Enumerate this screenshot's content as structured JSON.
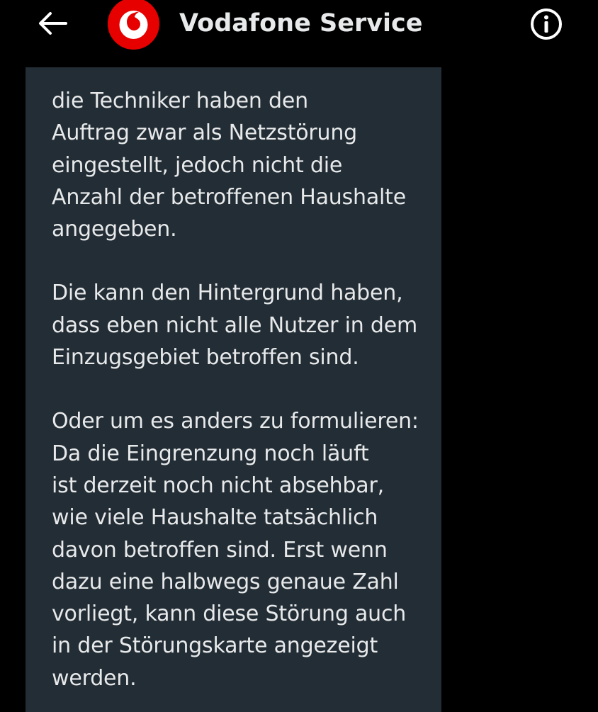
{
  "header": {
    "back_icon": "arrow-left-icon",
    "avatar_icon": "vodafone-logo-icon",
    "title": "Vodafone Service",
    "info_icon": "info-circle-icon",
    "brand_color": "#e60000"
  },
  "message": {
    "background_color": "#232d35",
    "paragraphs": [
      {
        "lines": [
          "die Techniker haben den",
          "Auftrag zwar als Netzstörung",
          "eingestellt, jedoch nicht die",
          "Anzahl der betroffenen Haushalte",
          "angegeben."
        ]
      },
      {
        "lines": [
          "Die kann den Hintergrund haben,",
          "dass eben nicht alle Nutzer in dem",
          "Einzugsgebiet betroffen sind."
        ]
      },
      {
        "lines": [
          "Oder um es anders zu formulieren:",
          "Da die Eingrenzung noch läuft",
          "ist derzeit noch nicht absehbar,",
          "wie viele Haushalte tatsächlich",
          "davon betroffen sind. Erst wenn",
          "dazu eine halbwegs genaue Zahl",
          "vorliegt, kann diese Störung auch",
          "in der Störungskarte angezeigt",
          "werden."
        ]
      }
    ]
  }
}
